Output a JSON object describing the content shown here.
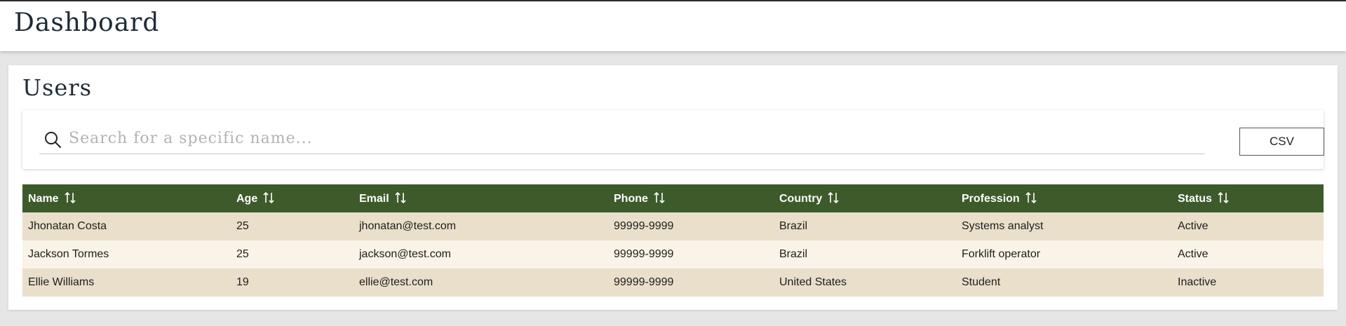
{
  "header": {
    "title": "Dashboard"
  },
  "users_section": {
    "title": "Users",
    "search": {
      "placeholder": "Search for a specific name...",
      "value": ""
    },
    "csv_button_label": "CSV"
  },
  "table": {
    "columns": [
      "Name",
      "Age",
      "Email",
      "Phone",
      "Country",
      "Profession",
      "Status"
    ],
    "rows": [
      [
        "Jhonatan Costa",
        "25",
        "jhonatan@test.com",
        "99999-9999",
        "Brazil",
        "Systems analyst",
        "Active"
      ],
      [
        "Jackson Tormes",
        "25",
        "jackson@test.com",
        "99999-9999",
        "Brazil",
        "Forklift operator",
        "Active"
      ],
      [
        "Ellie Williams",
        "19",
        "ellie@test.com",
        "99999-9999",
        "United States",
        "Student",
        "Inactive"
      ]
    ]
  },
  "colors": {
    "header_green": "#3d5a2a",
    "row_odd": "#e9dfca",
    "row_even": "#faf3e7",
    "background": "#e6e6e6"
  },
  "icons": [
    "search-icon",
    "sort-icon"
  ]
}
